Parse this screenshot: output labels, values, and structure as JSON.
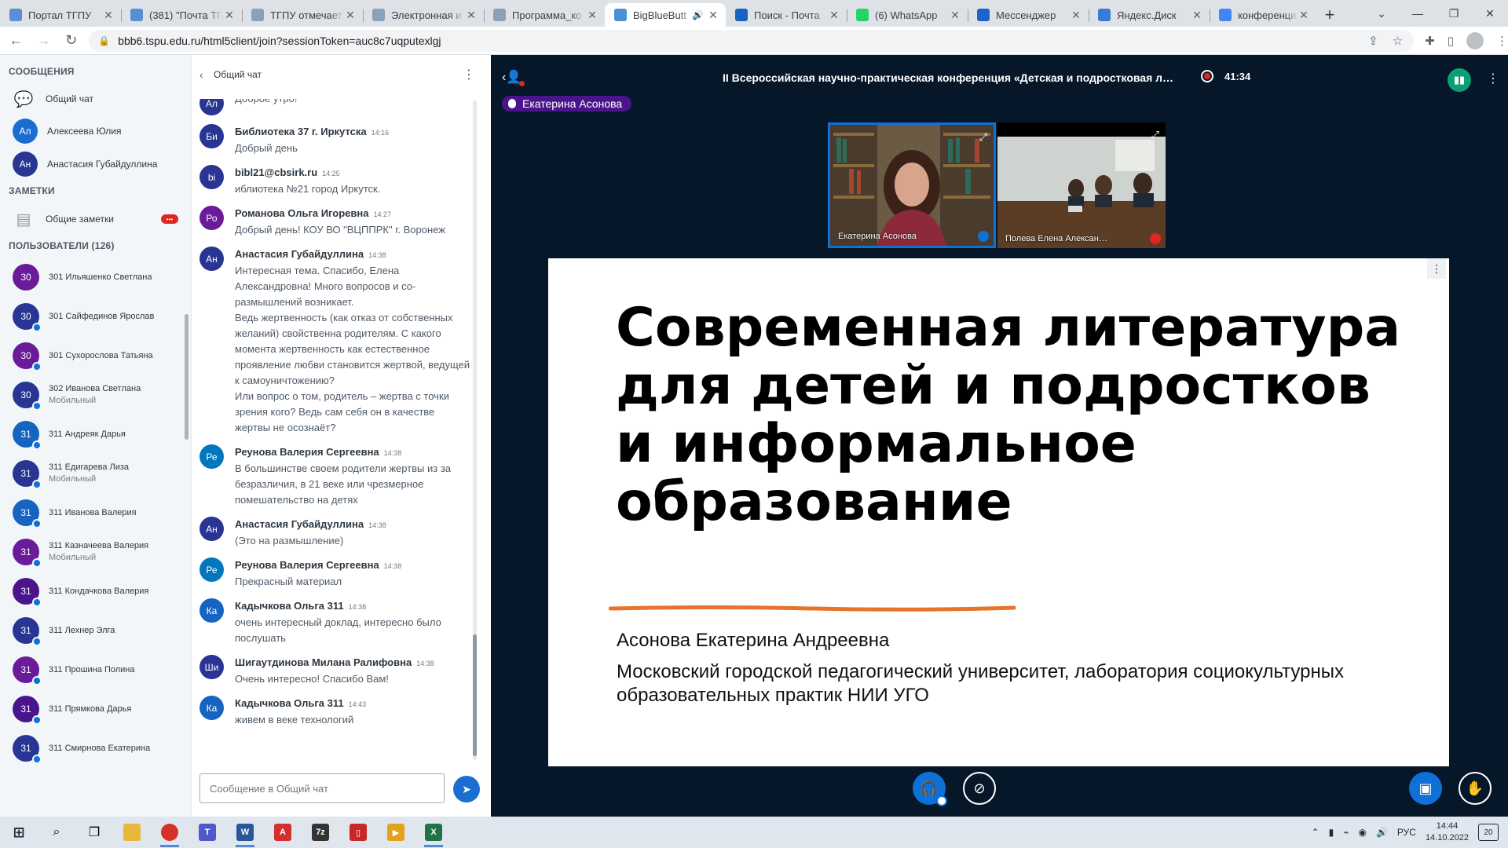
{
  "browser": {
    "tabs": [
      {
        "title": "Портал ТГПУ",
        "fav_color": "#5a8fd6",
        "active": false
      },
      {
        "title": "(381) \"Почта ТГ",
        "fav_color": "#5a8fd6",
        "active": false
      },
      {
        "title": "ТГПУ отмечает",
        "fav_color": "#8aa1b8",
        "active": false
      },
      {
        "title": "Электронная и",
        "fav_color": "#8aa1b8",
        "active": false
      },
      {
        "title": "Программа_ко",
        "fav_color": "#8aa1b8",
        "active": false
      },
      {
        "title": "BigBlueButt",
        "fav_color": "#4a90d6",
        "active": true
      },
      {
        "title": "Поиск - Почта",
        "fav_color": "#1565c0",
        "active": false
      },
      {
        "title": "(6) WhatsApp",
        "fav_color": "#25d366",
        "active": false
      },
      {
        "title": "Мессенджер",
        "fav_color": "#1e63c9",
        "active": false
      },
      {
        "title": "Яндекс.Диск",
        "fav_color": "#3a7bd5",
        "active": false
      },
      {
        "title": "конференция С",
        "fav_color": "#4285f4",
        "active": false
      }
    ],
    "url": "bbb6.tspu.edu.ru/html5client/join?sessionToken=auc8c7uqputexlgj"
  },
  "left_panel": {
    "messages_title": "СООБЩЕНИЯ",
    "public_chat": "Общий чат",
    "private_chats": [
      {
        "initials": "Ал",
        "name": "Алексеева Юлия",
        "color": "#1b6ed1"
      },
      {
        "initials": "Ан",
        "name": "Анастасия Губайдуллина",
        "color": "#283593"
      }
    ],
    "notes_title": "ЗАМЕТКИ",
    "shared_notes": "Общие заметки",
    "notes_badge": "•••",
    "users_title": "ПОЛЬЗОВАТЕЛИ (126)",
    "users": [
      {
        "initials": "30",
        "name": "301 Ильяшенко Светлана",
        "sub": "",
        "color": "#6a1b9a"
      },
      {
        "initials": "30",
        "name": "301 Сайфединов Ярослав",
        "sub": "",
        "color": "#283593"
      },
      {
        "initials": "30",
        "name": "301 Сухорослова Татьяна",
        "sub": "",
        "color": "#6a1b9a"
      },
      {
        "initials": "30",
        "name": "302 Иванова Светлана",
        "sub": "Мобильный",
        "color": "#283593"
      },
      {
        "initials": "31",
        "name": "311 Андреяк Дарья",
        "sub": "",
        "color": "#1565c0"
      },
      {
        "initials": "31",
        "name": "311 Едигарева Лиза",
        "sub": "Мобильный",
        "color": "#283593"
      },
      {
        "initials": "31",
        "name": "311 Иванова Валерия",
        "sub": "",
        "color": "#1565c0"
      },
      {
        "initials": "31",
        "name": "311 Казначеева Валерия",
        "sub": "Мобильный",
        "color": "#6a1b9a"
      },
      {
        "initials": "31",
        "name": "311 Кондачкова Валерия",
        "sub": "",
        "color": "#4a148c"
      },
      {
        "initials": "31",
        "name": "311 Лехнер Элга",
        "sub": "",
        "color": "#283593"
      },
      {
        "initials": "31",
        "name": "311 Прошина Полина",
        "sub": "",
        "color": "#6a1b9a"
      },
      {
        "initials": "31",
        "name": "311 Прямкова Дарья",
        "sub": "",
        "color": "#4a148c"
      },
      {
        "initials": "31",
        "name": "311 Смирнова Екатерина",
        "sub": "",
        "color": "#283593"
      }
    ]
  },
  "chat": {
    "title": "Общий чат",
    "messages": [
      {
        "initials": "Ал",
        "name": "",
        "time": "",
        "text": "Доброе утро!",
        "color": "#283593"
      },
      {
        "initials": "Би",
        "name": "Библиотека 37 г. Иркутска",
        "time": "14:16",
        "text": "Добрый день",
        "color": "#283593"
      },
      {
        "initials": "bi",
        "name": "bibl21@cbsirk.ru",
        "time": "14:25",
        "text": "иблиотека №21 город Иркутск.",
        "color": "#283593"
      },
      {
        "initials": "Ро",
        "name": "Романова Ольга Игоревна",
        "time": "14:27",
        "text": "Добрый день! КОУ ВО \"ВЦППРК\" г. Воронеж",
        "color": "#6a1b9a"
      },
      {
        "initials": "Ан",
        "name": "Анастасия Губайдуллина",
        "time": "14:38",
        "text": "Интересная тема. Спасибо, Елена Александровна! Много вопросов и со-размышлений возникает.\nВедь жертвенность (как отказ от собственных желаний) свойственна родителям. С какого момента жертвенность как естественное проявление любви становится жертвой, ведущей к самоуничтожению?\nИли вопрос о том, родитель – жертва с точки зрения кого? Ведь сам себя он в качестве жертвы не осознаёт?",
        "color": "#283593"
      },
      {
        "initials": "Ре",
        "name": "Реунова Валерия Сергеевна",
        "time": "14:38",
        "text": "В большинстве своем родители жертвы из за безразличия, в 21 веке или чрезмерное помешательство на детях",
        "color": "#0277bd"
      },
      {
        "initials": "Ан",
        "name": "Анастасия Губайдуллина",
        "time": "14:38",
        "text": "(Это на размышление)",
        "color": "#283593"
      },
      {
        "initials": "Ре",
        "name": "Реунова Валерия Сергеевна",
        "time": "14:38",
        "text": "Прекрасный материал",
        "color": "#0277bd"
      },
      {
        "initials": "Ка",
        "name": "Кадычкова Ольга 311",
        "time": "14:38",
        "text": "очень интересный доклад, интересно было послушать",
        "color": "#1565c0"
      },
      {
        "initials": "Ши",
        "name": "Шигаутдинова Милана Ралифовна",
        "time": "14:38",
        "text": "Очень интересно! Спасибо Вам!",
        "color": "#283593"
      },
      {
        "initials": "Ка",
        "name": "Кадычкова Ольга 311",
        "time": "14:43",
        "text": "живем в веке технологий",
        "color": "#1565c0"
      }
    ],
    "input_placeholder": "Сообщение в Общий чат"
  },
  "stage": {
    "meeting_title": "II Всероссийская научно-практическая конференция «Детская и подростковая литерат…",
    "recording_time": "41:34",
    "talking": "Екатерина Асонова",
    "videos": [
      {
        "name": "Екатерина Асонова",
        "muted": false
      },
      {
        "name": "Полева Елена Алексан…",
        "muted": true
      }
    ],
    "slide": {
      "title": "Современная литература для детей и подростков и информальное образование",
      "author": "Асонова Екатерина Андреевна",
      "affiliation": "Московский городской педагогический университет, лаборатория социокультурных образовательных практик НИИ УГО"
    }
  },
  "taskbar": {
    "lang": "РУС",
    "time": "14:44",
    "date": "14.10.2022",
    "notifications": "20"
  }
}
